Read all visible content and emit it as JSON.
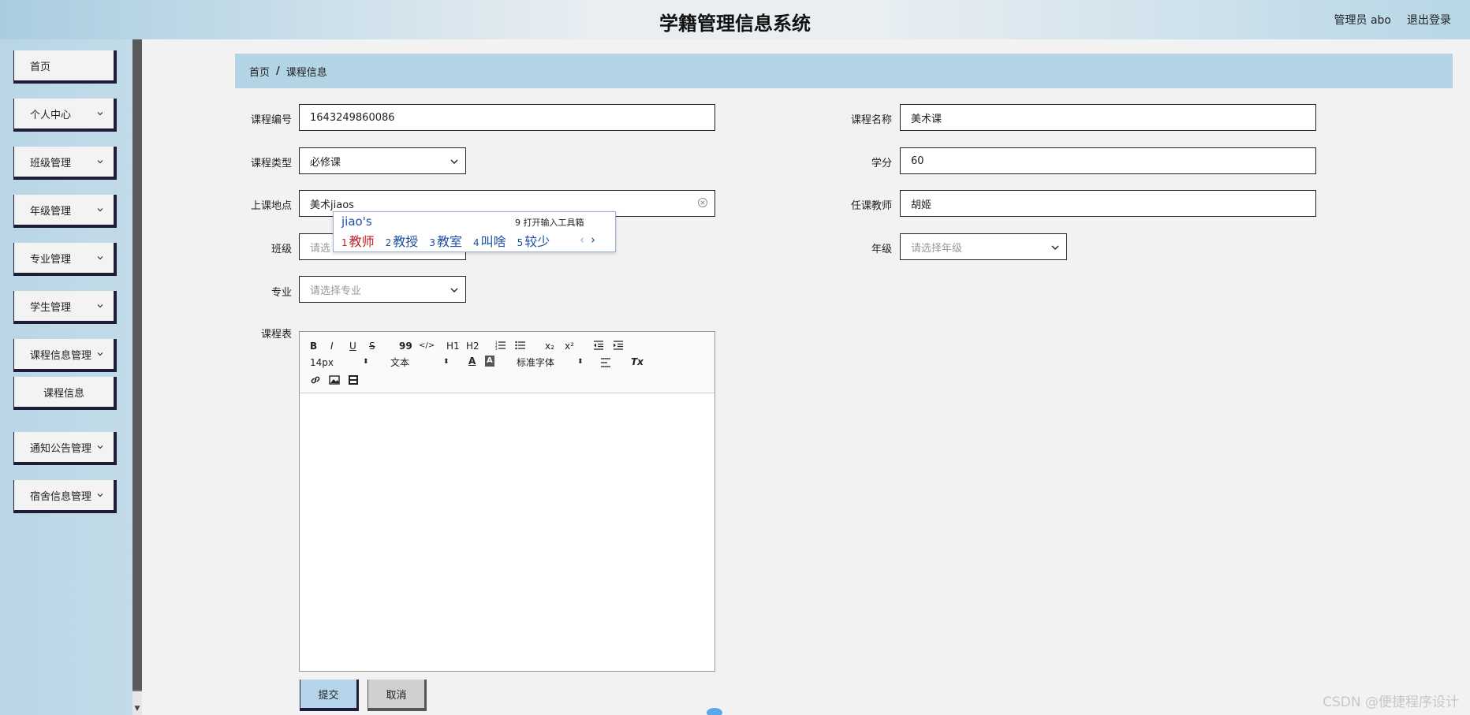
{
  "header": {
    "title": "学籍管理信息系统",
    "user_label": "管理员 abo",
    "logout_label": "退出登录"
  },
  "sidebar": {
    "items": [
      {
        "label": "首页",
        "expandable": false
      },
      {
        "label": "个人中心",
        "expandable": true
      },
      {
        "label": "班级管理",
        "expandable": true
      },
      {
        "label": "年级管理",
        "expandable": true
      },
      {
        "label": "专业管理",
        "expandable": true
      },
      {
        "label": "学生管理",
        "expandable": true
      },
      {
        "label": "课程信息管理",
        "expandable": true
      },
      {
        "label": "课程信息",
        "expandable": false,
        "sub": true
      },
      {
        "label": "通知公告管理",
        "expandable": true
      },
      {
        "label": "宿舍信息管理",
        "expandable": true
      }
    ]
  },
  "breadcrumb": {
    "home": "首页",
    "separator": "/",
    "current": "课程信息"
  },
  "form": {
    "course_code": {
      "label": "课程编号",
      "value": "1643249860086"
    },
    "course_name": {
      "label": "课程名称",
      "value": "美术课"
    },
    "course_type": {
      "label": "课程类型",
      "value": "必修课"
    },
    "credits": {
      "label": "学分",
      "value": "60"
    },
    "location": {
      "label": "上课地点",
      "value": "美术jiaos"
    },
    "teacher": {
      "label": "任课教师",
      "value": "胡姬"
    },
    "class": {
      "label": "班级",
      "placeholder": "请选"
    },
    "grade": {
      "label": "年级",
      "placeholder": "请选择年级"
    },
    "major": {
      "label": "专业",
      "placeholder": "请选择专业"
    },
    "schedule": {
      "label": "课程表"
    }
  },
  "ime": {
    "composition": "jiao's",
    "tool": "9 打开输入工具箱",
    "candidates": [
      {
        "num": "1",
        "text": "教师"
      },
      {
        "num": "2",
        "text": "教授"
      },
      {
        "num": "3",
        "text": "教室"
      },
      {
        "num": "4",
        "text": "叫啥"
      },
      {
        "num": "5",
        "text": "较少"
      }
    ],
    "prev": "‹",
    "next": "›"
  },
  "editor": {
    "font_size": "14px",
    "text_type": "文本",
    "font_family": "标准字体",
    "buttons": {
      "bold": "B",
      "italic": "I",
      "underline": "U",
      "strike": "S",
      "quote": "99",
      "code": "</>",
      "h1": "H1",
      "h2": "H2",
      "sub": "x₂",
      "sup": "x²",
      "clear": "Tx"
    }
  },
  "actions": {
    "submit": "提交",
    "cancel": "取消"
  },
  "watermark": "CSDN @便捷程序设计"
}
